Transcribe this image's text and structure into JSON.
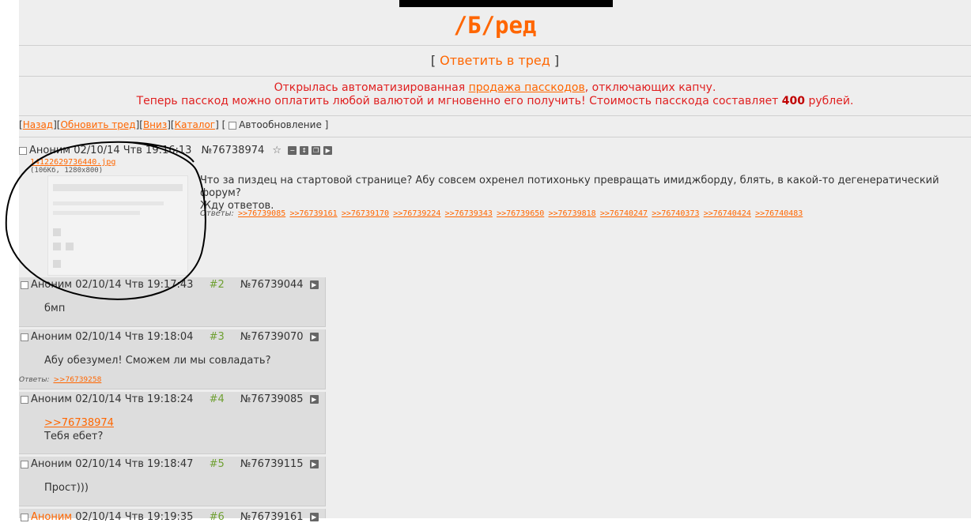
{
  "board": {
    "title": "/Б/ред"
  },
  "reply_link": {
    "open": "[",
    "label": "Ответить в тред",
    "close": "]"
  },
  "announcement": {
    "line1_prefix": "Открылась автоматизированная ",
    "line1_link": "продажа пасскодов",
    "line1_suffix": ", отключающих капчу.",
    "line2_prefix": "Теперь пасскод можно оплатить любой валютой и мгновенно его получить! Стоимость пасскода составляет ",
    "line2_amount": "400",
    "line2_suffix": " рублей."
  },
  "nav": {
    "back": "Назад",
    "refresh": "Обновить тред",
    "down": "Вниз",
    "catalog": "Каталог",
    "autoupdate": "Автообновление"
  },
  "op": {
    "name": "Аноним",
    "datetime": "02/10/14 Чтв 19:16:13",
    "number": "№76738974",
    "file_name": "14122629736440.jpg",
    "file_info": "(106Кб, 1280x800)",
    "text_line1": "Что за пиздец на стартовой странице? Абу совсем охренел потихоньку превращать имиджборду, блять, в какой-то дегенератический форум?",
    "text_line2": "Жду ответов.",
    "replies_label": "Ответы:",
    "replies": [
      ">>76739085",
      ">>76739161",
      ">>76739170",
      ">>76739224",
      ">>76739343",
      ">>76739650",
      ">>76739818",
      ">>76740247",
      ">>76740373",
      ">>76740424",
      ">>76740483"
    ]
  },
  "posts": [
    {
      "name": "Аноним",
      "datetime": "02/10/14 Чтв 19:17:43",
      "index": "#2",
      "number": "№76739044",
      "text": "бмп"
    },
    {
      "name": "Аноним",
      "datetime": "02/10/14 Чтв 19:18:04",
      "index": "#3",
      "number": "№76739070",
      "text": "Абу обезумел! Сможем ли мы совладать?",
      "replies_label": "Ответы:",
      "replies": [
        ">>76739258"
      ]
    },
    {
      "name": "Аноним",
      "datetime": "02/10/14 Чтв 19:18:24",
      "index": "#4",
      "number": "№76739085",
      "quote": ">>76738974",
      "text": "Тебя ебет?"
    },
    {
      "name": "Аноним",
      "datetime": "02/10/14 Чтв 19:18:47",
      "index": "#5",
      "number": "№76739115",
      "text": "Прост)))"
    },
    {
      "name": "Аноним",
      "datetime": "02/10/14 Чтв 19:19:35",
      "index": "#6",
      "number": "№76739161"
    }
  ],
  "colors": {
    "accent": "#ff6600",
    "announce": "#e02020",
    "post_bg": "#dddddd",
    "page_bg": "#eeeeee",
    "post_index": "#6fa032"
  },
  "icons": [
    "star-icon",
    "hide-icon",
    "expand-icon",
    "report-icon",
    "play-icon"
  ]
}
